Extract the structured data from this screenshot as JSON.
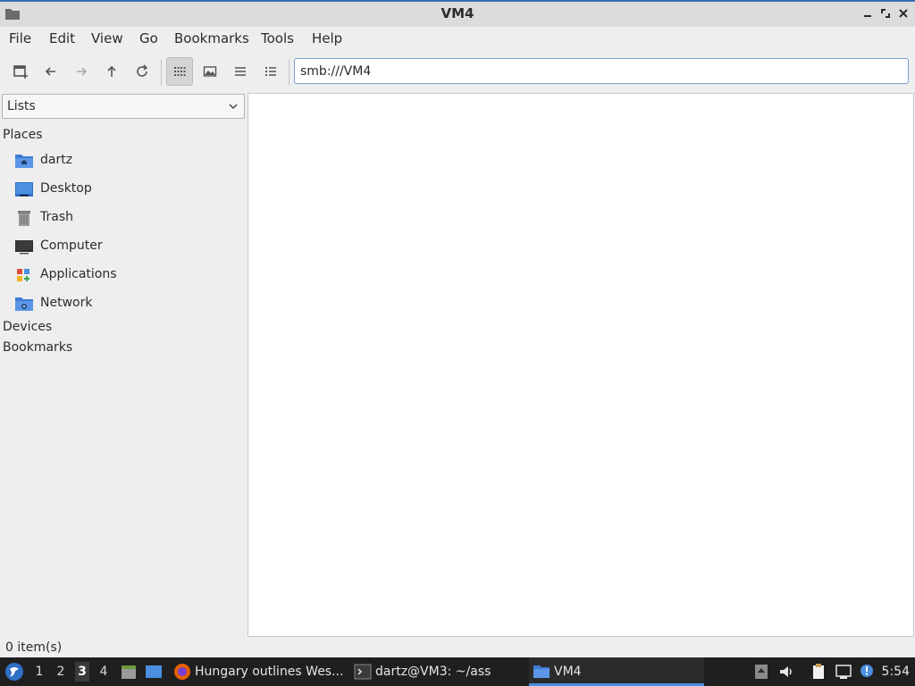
{
  "window": {
    "title": "VM4"
  },
  "menu": [
    "File",
    "Edit",
    "View",
    "Go",
    "Bookmarks",
    "Tools",
    "Help"
  ],
  "path": {
    "value": "smb:///VM4"
  },
  "sidebar": {
    "selector": "Lists",
    "places_heading": "Places",
    "places": [
      {
        "label": "dartz",
        "icon": "home-folder-icon"
      },
      {
        "label": "Desktop",
        "icon": "desktop-icon"
      },
      {
        "label": "Trash",
        "icon": "trash-icon"
      },
      {
        "label": "Computer",
        "icon": "computer-icon"
      },
      {
        "label": "Applications",
        "icon": "applications-icon"
      },
      {
        "label": "Network",
        "icon": "network-folder-icon"
      }
    ],
    "devices_heading": "Devices",
    "bookmarks_heading": "Bookmarks"
  },
  "status": {
    "text": "0 item(s)"
  },
  "taskbar": {
    "workspaces": [
      "1",
      "2",
      "3",
      "4"
    ],
    "active_workspace": "3",
    "tasks": [
      {
        "label": "Hungary outlines Wes...",
        "icon": "firefox-icon"
      },
      {
        "label": "dartz@VM3: ~/ass",
        "icon": "terminal-icon"
      },
      {
        "label": "VM4",
        "icon": "folder-icon"
      }
    ],
    "clock": "5:54"
  },
  "colors": {
    "accent": "#4a8fe0",
    "folder": "#3d7dd6",
    "taskbar": "#1f1f1f"
  }
}
